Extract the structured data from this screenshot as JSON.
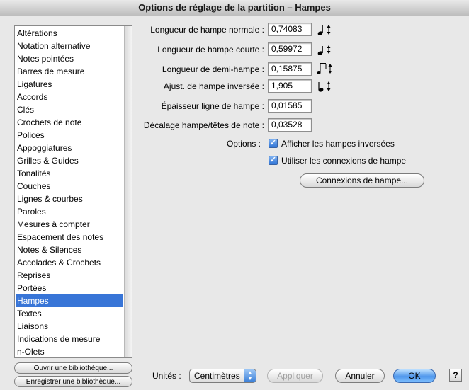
{
  "window": {
    "title": "Options de réglage de la partition – Hampes"
  },
  "sidebar": {
    "items": [
      "Altérations",
      "Notation alternative",
      "Notes pointées",
      "Barres de mesure",
      "Ligatures",
      "Accords",
      "Clés",
      "Crochets de note",
      "Polices",
      "Appoggiatures",
      "Grilles & Guides",
      "Tonalités",
      "Couches",
      "Lignes & courbes",
      "Paroles",
      "Mesures à compter",
      "Espacement des notes",
      "Notes & Silences",
      "Accolades & Crochets",
      "Reprises",
      "Portées",
      "Hampes",
      "Textes",
      "Liaisons",
      "Indications de mesure",
      "n-Olets"
    ],
    "selected": "Hampes",
    "open_library": "Ouvrir une bibliothèque...",
    "save_library": "Enregistrer une bibliothèque..."
  },
  "fields": {
    "normal_length": {
      "label": "Longueur de hampe normale :",
      "value": "0,74083",
      "icon": "quarter-note-arrows-icon"
    },
    "short_length": {
      "label": "Longueur de hampe courte :",
      "value": "0,59972",
      "icon": "eighth-note-arrows-icon"
    },
    "half_length": {
      "label": "Longueur de demi-hampe :",
      "value": "0,15875",
      "icon": "beamed-note-arrows-icon"
    },
    "reverse_adjust": {
      "label": "Ajust. de hampe inversée :",
      "value": "1,905",
      "icon": "down-stem-arrows-icon"
    },
    "line_thickness": {
      "label": "Épaisseur ligne de hampe :",
      "value": "0,01585"
    },
    "stem_offset": {
      "label": "Décalage hampe/têtes de note :",
      "value": "0,03528"
    }
  },
  "options": {
    "label": "Options :",
    "show_reversed": {
      "label": "Afficher les hampes inversées",
      "checked": true
    },
    "use_connections": {
      "label": "Utiliser les connexions de hampe",
      "checked": true
    },
    "connections_button": "Connexions de hampe..."
  },
  "footer": {
    "units_label": "Unités :",
    "units_value": "Centimètres",
    "apply": "Appliquer",
    "cancel": "Annuler",
    "ok": "OK",
    "help": "?"
  },
  "colors": {
    "selection": "#3875d7",
    "default_button": "#4f97ec"
  }
}
